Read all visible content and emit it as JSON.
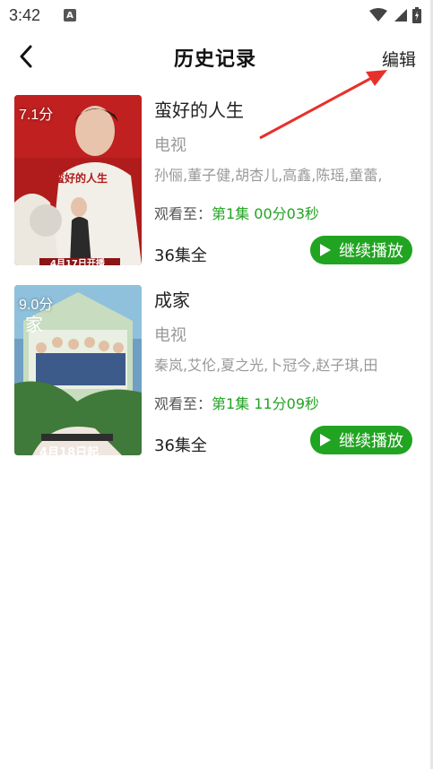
{
  "status_bar": {
    "time": "3:42",
    "notification_badge": "A",
    "icons": [
      "wifi-icon",
      "signal-icon",
      "battery-icon"
    ]
  },
  "header": {
    "title": "历史记录",
    "edit_label": "编辑",
    "back_icon": "chevron-left-icon"
  },
  "colors": {
    "accent": "#21a421",
    "annotation_arrow": "#e8302a"
  },
  "history": [
    {
      "score": "7.1分",
      "title": "蛮好的人生",
      "category": "电视",
      "cast": "孙俪,董子健,胡杏儿,高鑫,陈瑶,童蕾,",
      "progress_label": "观看至：",
      "progress_value": "第1集 00分03秒",
      "episodes": "36集全",
      "continue_label": "继续播放",
      "poster_text": "蛮好的人生",
      "poster_date": "4月17日开播"
    },
    {
      "score": "9.0分",
      "title": "成家",
      "category": "电视",
      "cast": "秦岚,艾伦,夏之光,卜冠今,赵子琪,田",
      "progress_label": "观看至：",
      "progress_value": "第1集 11分09秒",
      "episodes": "36集全",
      "continue_label": "继续播放",
      "poster_text": "家",
      "poster_date": "4月18日起"
    }
  ]
}
